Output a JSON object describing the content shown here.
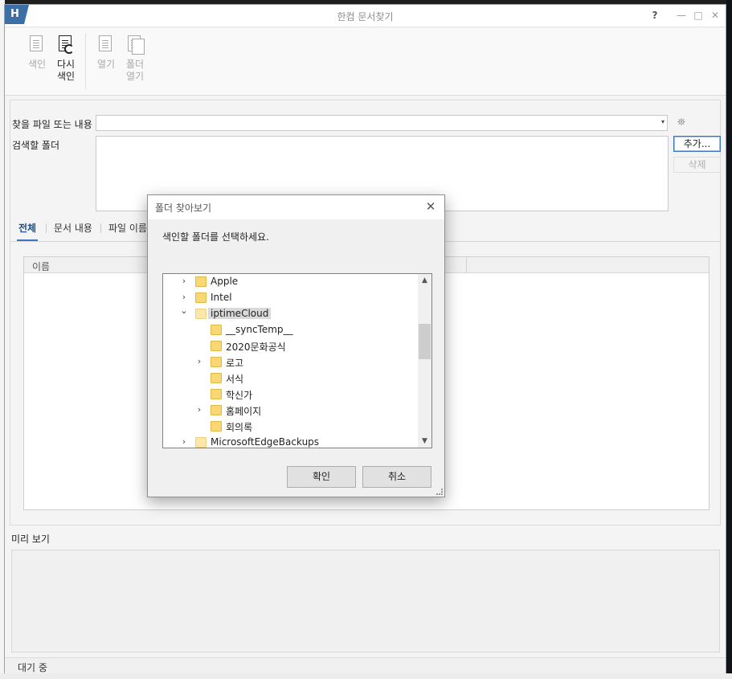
{
  "window": {
    "app_icon": "H",
    "title": "한컴 문서찾기",
    "help": "?",
    "minimize": "—",
    "maximize": "□",
    "close": "✕"
  },
  "ribbon": {
    "index_label": "색인",
    "reindex_label_1": "다시",
    "reindex_label_2": "색인",
    "open_label": "열기",
    "open_folder_label_1": "폴더",
    "open_folder_label_2": "열기"
  },
  "search": {
    "query_label": "찾을 파일 또는 내용",
    "query_value": "",
    "combo_arrow": "▾",
    "binoculars": "⛯",
    "folder_label": "검색할 폴더",
    "add_button": "추가...",
    "delete_button": "삭제"
  },
  "tabs": [
    "전체",
    "문서 내용",
    "파일 이름"
  ],
  "results": {
    "columns": [
      "이름"
    ]
  },
  "preview_label": "미리 보기",
  "status": "대기 중",
  "dialog": {
    "title": "폴더 찾아보기",
    "close": "✕",
    "message": "색인할 폴더를 선택하세요.",
    "tree": [
      {
        "name": "Apple",
        "chevron": "›"
      },
      {
        "name": "Intel",
        "chevron": "›"
      },
      {
        "name": "iptimeCloud",
        "chevron": "⌄"
      },
      {
        "name": "__syncTemp__",
        "chevron": ""
      },
      {
        "name": "2020문화공식",
        "chevron": ""
      },
      {
        "name": "로고",
        "chevron": "›"
      },
      {
        "name": "서식",
        "chevron": ""
      },
      {
        "name": "학신가",
        "chevron": ""
      },
      {
        "name": "홈페이지",
        "chevron": "›"
      },
      {
        "name": "회의록",
        "chevron": ""
      },
      {
        "name": "MicrosoftEdgeBackups",
        "chevron": "›"
      }
    ],
    "scroll_up": "▲",
    "scroll_down": "▼",
    "ok_button": "확인",
    "cancel_button": "취소"
  }
}
